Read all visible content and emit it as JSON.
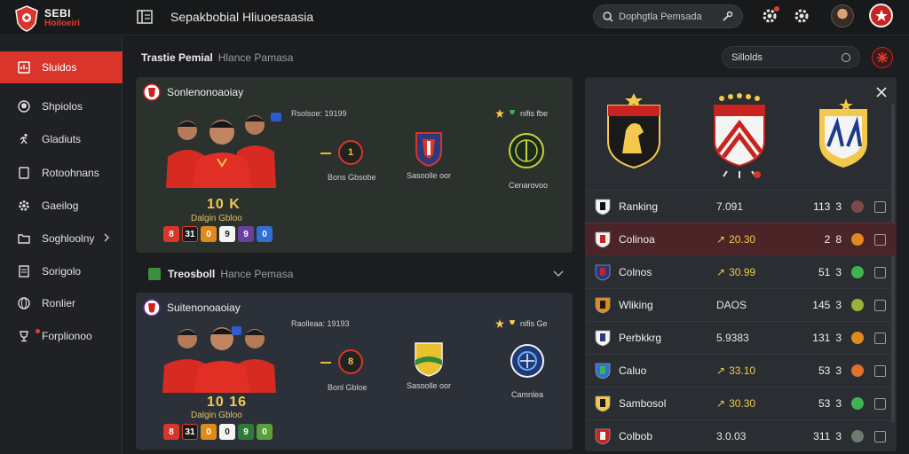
{
  "header": {
    "logo_line1": "SEBI",
    "logo_line2": "Hoiloeiri",
    "title": "Sepakbobial Hliuoesaasia",
    "search_placeholder": "Dophgtla Pemsada"
  },
  "sidebar": {
    "items": [
      {
        "label": "Sluidos",
        "icon": "dashboard-icon",
        "active": true
      },
      {
        "label": "Shpiolos",
        "icon": "ball-icon"
      },
      {
        "label": "Gladiuts",
        "icon": "runner-icon"
      },
      {
        "label": "Rotoohnans",
        "icon": "tablet-icon"
      },
      {
        "label": "Gaeilog",
        "icon": "gear-icon"
      },
      {
        "label": "Soghloolny",
        "icon": "folder-icon",
        "has_submenu": true
      },
      {
        "label": "Sorigolo",
        "icon": "document-icon"
      },
      {
        "label": "Ronlier",
        "icon": "globe-icon"
      },
      {
        "label": "Forplionoo",
        "icon": "trophy-icon",
        "badge_dot": true
      }
    ]
  },
  "main": {
    "section1_title": "Trastie Pemial",
    "section1_sub": "Hlance Pamasa",
    "sort_label": "Sillolds",
    "section2_title": "Treosboll",
    "section2_sub": "Hance Pemasa",
    "cards": [
      {
        "title": "Sonlenonoaoiay",
        "meta_top": "Rsolsoe: 19199",
        "score_big": "10 K",
        "score_sub": "Dalgin Gbloo",
        "pill": "1",
        "mid_label": "Bons Gbsobe",
        "crest2_label": "Sasoolle oor",
        "crest3_label": "Cenarovoo",
        "fav_text": "nifis fbe",
        "chips": [
          "8",
          "31",
          "0",
          "9",
          "9",
          "0"
        ]
      },
      {
        "title": "Suitenonoaoiay",
        "meta_top": "Raolleaa: 19193",
        "score_big": "10 16",
        "score_sub": "Dalgin Gbloo",
        "pill": "8",
        "mid_label": "Bonl Gbloe",
        "crest2_label": "Sasoolle oor",
        "crest3_label": "Camnlea",
        "fav_text": "nifis Ge",
        "chips": [
          "8",
          "31",
          "0",
          "0",
          "9",
          "0"
        ]
      }
    ]
  },
  "ranking": {
    "rows": [
      {
        "name": "Ranking",
        "val": "7.091",
        "trend": "",
        "pts": "113",
        "pts2": "3",
        "dot": "#7a4a4a",
        "logo": "juve-logo",
        "highlight": false
      },
      {
        "name": "Colinoa",
        "val": "20.30",
        "trend": "↗",
        "pts": "2",
        "pts2": "8",
        "dot": "#e08a1e",
        "logo": "striped-red-logo",
        "highlight": true
      },
      {
        "name": "Colnos",
        "val": "30.99",
        "trend": "↗",
        "pts": "51",
        "pts2": "3",
        "dot": "#3fb34f",
        "logo": "blue-red-logo",
        "highlight": false
      },
      {
        "name": "Wliking",
        "val": "DAOS",
        "trend": "",
        "pts": "145",
        "pts2": "3",
        "dot": "#9ab03a",
        "logo": "orange-logo",
        "highlight": false
      },
      {
        "name": "Perbkkrg",
        "val": "5.9383",
        "trend": "",
        "pts": "131",
        "pts2": "3",
        "dot": "#e08a1e",
        "logo": "white-crest-logo",
        "highlight": false
      },
      {
        "name": "Caluo",
        "val": "33.10",
        "trend": "↗",
        "pts": "53",
        "pts2": "3",
        "dot": "#e0702a",
        "logo": "blue-green-logo",
        "highlight": false
      },
      {
        "name": "Sambosol",
        "val": "30.30",
        "trend": "↗",
        "pts": "53",
        "pts2": "3",
        "dot": "#3fb34f",
        "logo": "gold-logo",
        "highlight": false
      },
      {
        "name": "Colbob",
        "val": "3.0.03",
        "trend": "",
        "pts": "311",
        "pts2": "3",
        "dot": "#6e7a72",
        "logo": "red-white-logo",
        "highlight": false
      }
    ]
  },
  "colors": {
    "accent": "#d9352a",
    "gold": "#f2c94c",
    "card1": "#2b312c",
    "card2": "#2c3139",
    "panel": "#2a2d31"
  }
}
